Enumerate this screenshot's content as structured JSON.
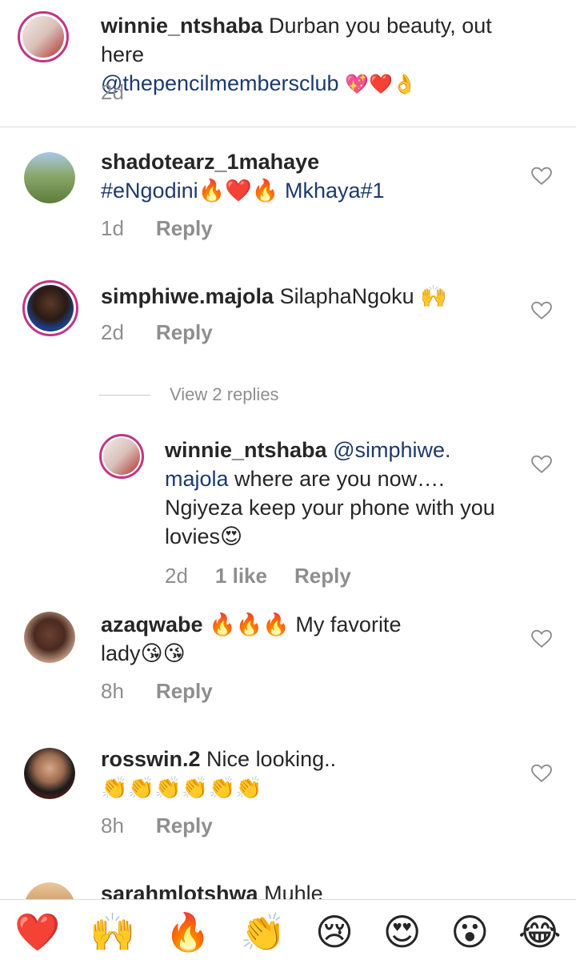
{
  "comments": [
    {
      "user": "winnie_ntshaba",
      "text": " Durban you beauty, out here ",
      "mention": "@thepencilmembersclub",
      "emoji": "💖❤️👌",
      "time": "2d"
    },
    {
      "user": "shadotearz_1mahaye",
      "text": "#eNgodini🔥❤️🔥 Mkhaya#1",
      "time": "1d",
      "reply": "Reply"
    },
    {
      "user": "simphiwe.majola",
      "text": " SilaphaNgoku 🙌",
      "time": "2d",
      "reply": "Reply"
    },
    {
      "view_replies": "View 2 replies"
    },
    {
      "user": "winnie_ntshaba",
      "mention": "@simphiwe.",
      "mention2": "majola",
      "text": " where are you now….",
      "text2": "Ngiyeza keep your phone with you",
      "text3": "lovies😍",
      "time": "2d",
      "likes": "1 like",
      "reply": "Reply"
    },
    {
      "user": "azaqwabe",
      "text": " 🔥🔥🔥 My favorite",
      "text2": "lady😘😘",
      "time": "8h",
      "reply": "Reply"
    },
    {
      "user": "rosswin.2",
      "text": " Nice looking..",
      "text2": "👏👏👏👏👏👏",
      "time": "8h",
      "reply": "Reply"
    },
    {
      "user": "sarahmlotshwa",
      "text": " Muhle"
    }
  ],
  "reactions": [
    "❤️",
    "🙌",
    "🔥",
    "👏",
    "😢",
    "😍",
    "😮",
    "😂"
  ],
  "colors": {
    "accent_ring": "#c13584",
    "mention": "#1d3a6e",
    "meta": "#8e8e8e"
  }
}
